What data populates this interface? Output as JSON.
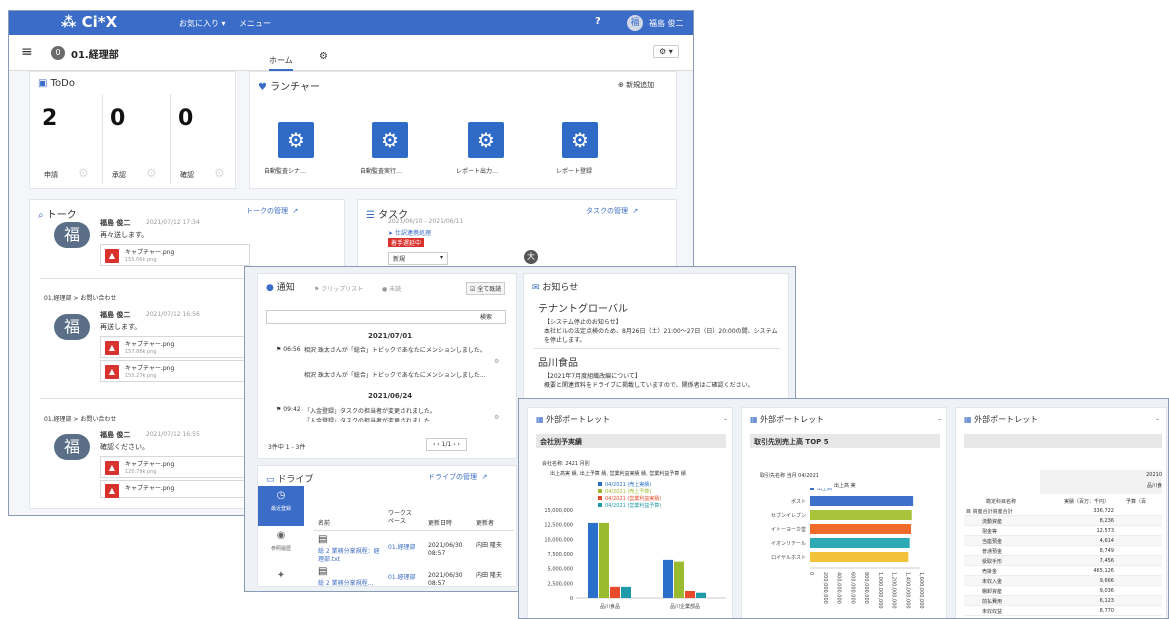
{
  "app": {
    "logo": "Ci*X",
    "fav_menu": "お気に入り ▾",
    "menu": "メニュー",
    "user_initial": "福",
    "user_name": "福島 俊二",
    "help": "?"
  },
  "subheader": {
    "badge": "0",
    "title": "01.経理部",
    "tab_home": "ホーム",
    "settings": "⚙ ▾"
  },
  "todo": {
    "title": "ToDo",
    "counts": [
      "2",
      "0",
      "0"
    ],
    "labels": [
      "申請",
      "承認",
      "確認"
    ]
  },
  "launcher": {
    "title": "ランチャー",
    "add": "新規追加",
    "items": [
      "自動監査シナ…",
      "自動監査実行…",
      "レポート出力…",
      "レポート登録"
    ]
  },
  "talk": {
    "title": "トーク",
    "manage": "トークの管理",
    "threads": [
      {
        "context": "",
        "name": "福島 俊二",
        "time": "2021/07/12 17:34",
        "msg": "再々送します。",
        "files": [
          {
            "name": "キャプチャー.png",
            "size": "155.06k png"
          }
        ]
      },
      {
        "context": "01.経理部 > お問い合わせ",
        "name": "福島 俊二",
        "time": "2021/07/12 16:56",
        "msg": "再送します。",
        "files": [
          {
            "name": "キャプチャー.png",
            "size": "157.86k png"
          },
          {
            "name": "キャプチャー.png",
            "size": "155.27k png"
          }
        ]
      },
      {
        "context": "01.経理部 > お問い合わせ",
        "name": "福島 俊二",
        "time": "2021/07/12 16:55",
        "msg": "確認ください。",
        "files": [
          {
            "name": "キャプチャー.png",
            "size": "120.79k png"
          },
          {
            "name": "キャプチャー.png",
            "size": ""
          }
        ]
      }
    ]
  },
  "task": {
    "title": "タスク",
    "manage": "タスクの管理",
    "header": "2021/06/10 - 2021/06/11",
    "item": "仕訳連携処理",
    "badge": "着手遅延中",
    "status": "新規",
    "avatar": "大"
  },
  "notice": {
    "title": "通知",
    "tab_clip": "クリップリスト",
    "tab_unread": "未読",
    "read_all": "全て既読",
    "search": "検索",
    "groups": [
      {
        "date": "2021/07/01",
        "time": "06:56",
        "title": "相沢 珠太さんが「総合」トピックであなたにメンションしました。",
        "body": "相沢 珠太さんが「総合」トピックであなたにメンションしました..."
      },
      {
        "date": "2021/06/24",
        "time": "09:42",
        "title": "「入金登録」タスクの担当者が変更されました。",
        "body": "「入金登録」タスクの担当者が変更されました…"
      }
    ],
    "pager_text": "3件中 1 - 3件",
    "pager": "1/1"
  },
  "info": {
    "title": "お知らせ",
    "sections": [
      {
        "heading": "テナントグローバル",
        "body": "【システム停止のお知らせ】\n本社ビルの法定点検のため、8月26日（土）21:00〜27日（日）20:00の間、システムを停止します。"
      },
      {
        "heading": "品川食品",
        "body": "【2021年7月度組織改編について】\n概要と関連資料をドライブに掲載していますので、関係者はご確認ください。"
      }
    ]
  },
  "drive": {
    "title": "ドライブ",
    "manage": "ドライブの管理",
    "side": [
      "最近登録",
      "参照履歴",
      ""
    ],
    "columns": [
      "名前",
      "ワークスペース",
      "更新日時",
      "更新者"
    ],
    "rows": [
      {
        "name": "総 2 業務分掌規程：経理部.txt",
        "ws": "01.経理部",
        "date": "2021/06/30 08:57",
        "user": "内田 隆夫"
      },
      {
        "name": "総 2 業務分掌規程…",
        "ws": "01.経理部",
        "date": "2021/06/30 08:57",
        "user": "内田 隆夫"
      }
    ]
  },
  "portlets": [
    {
      "title": "外部ポートレット",
      "subtitle": "会社別予実績",
      "note": "会社名称: 2421 月別",
      "desc": "出上高実 績, 出上予算 績, 営業利益実績 績, 営業利益予算 績"
    },
    {
      "title": "外部ポートレット",
      "subtitle": "取引先別売上高 TOP 5",
      "note": "取引先名称 当月 04/2021",
      "desc": "出上高 実"
    },
    {
      "title": "外部ポートレット",
      "subtitle": "",
      "note": "",
      "desc": ""
    }
  ],
  "table_portlet": {
    "col_hdr": [
      "勘定科目名称",
      "実績（百万：千円）",
      "予算（百"
    ],
    "top_hdr": "20210",
    "top_sub": "品川食",
    "rows": [
      [
        "目 資産合計資産合計",
        "336,722"
      ],
      [
        "流動資産",
        "8,236"
      ],
      [
        "現金等",
        "12,573"
      ],
      [
        "当座預金",
        "4,614"
      ],
      [
        "普通預金",
        "8,749"
      ],
      [
        "受取手形",
        "7,456"
      ],
      [
        "売掛金",
        "465,126"
      ],
      [
        "未収入金",
        "9,666"
      ],
      [
        "棚卸資産",
        "9,036"
      ],
      [
        "前払費用",
        "6,123"
      ],
      [
        "未収収益",
        "8,770"
      ]
    ]
  },
  "chart_data": [
    {
      "type": "bar",
      "title": "会社別予実績",
      "categories": [
        "品川食品",
        "品川企業部品"
      ],
      "series": [
        {
          "name": "04/2021 (売上実績)",
          "values": [
            12800000,
            6500000
          ],
          "color": "#2a6fc9"
        },
        {
          "name": "04/2021 (売上予算)",
          "values": [
            12800000,
            6200000
          ],
          "color": "#9bbb2e"
        },
        {
          "name": "04/2021 (営業利益実績)",
          "values": [
            1900000,
            1200000
          ],
          "color": "#e84b2a"
        },
        {
          "name": "04/2021 (営業利益予算)",
          "values": [
            1900000,
            900000
          ],
          "color": "#1f9aa8"
        }
      ],
      "yticks": [
        "15,000,000",
        "12,500,000",
        "10,000,000",
        "7,500,000",
        "5,000,000",
        "2,500,000",
        "0"
      ],
      "ylim": [
        0,
        15000000
      ]
    },
    {
      "type": "bar",
      "orientation": "horizontal",
      "title": "取引先別売上高 TOP 5",
      "categories": [
        "ポスト",
        "セブンイレブン",
        "イトーヨーカ堂",
        "イオンリテール",
        "ロイヤルホスト"
      ],
      "series": [
        {
          "name": "出上高",
          "values": [
            1500000000,
            1480000000,
            1470000000,
            1450000000,
            1430000000
          ]
        }
      ],
      "colors": [
        "#3f70c9",
        "#a9c33a",
        "#f06b2a",
        "#2eaab5",
        "#f2c33a"
      ],
      "xticks": [
        "0",
        "200,000,000",
        "400,000,000",
        "600,000,000",
        "800,000,000",
        "1,000,000,000",
        "1,200,000,000",
        "1,400,000,000",
        "1,600,000,000"
      ]
    }
  ]
}
